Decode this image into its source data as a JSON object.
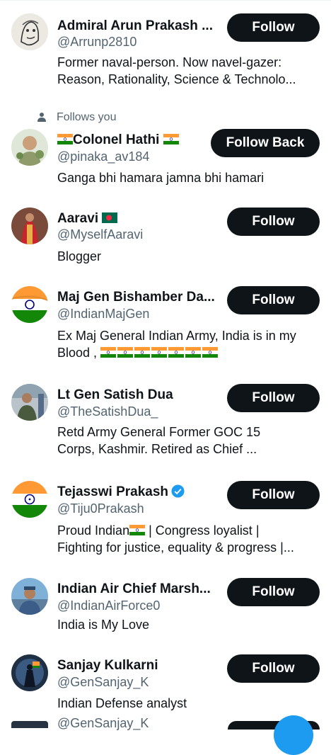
{
  "colors": {
    "text": "#0f1419",
    "muted": "#536471",
    "button": "#0f1419",
    "accent": "#1d9bf0"
  },
  "follows_you": {
    "icon": "person-icon",
    "label": "Follows you"
  },
  "users": [
    {
      "name": "Admiral Arun Prakash ...",
      "handle": "@Arrunp2810",
      "bio_lines": [
        "Former naval-person. Now navel-gazer:",
        "Reason, Rationality, Science & Technolo..."
      ],
      "button": "Follow"
    },
    {
      "name_prefix_flag": "india-flag",
      "name": "Colonel Hathi",
      "name_suffix_flag": "india-flag",
      "handle": "@pinaka_av184",
      "bio_lines": [
        "Ganga bhi hamara jamna bhi hamari"
      ],
      "button": "Follow Back"
    },
    {
      "name": "Aaravi",
      "name_suffix_flag": "bangladesh-flag",
      "handle": "@MyselfAaravi",
      "bio_lines": [
        "Blogger"
      ],
      "button": "Follow"
    },
    {
      "name": "Maj Gen Bishamber Da...",
      "handle": "@IndianMajGen",
      "bio_lines": [
        "Ex Maj General Indian Army, India is in my",
        "Blood , "
      ],
      "bio_flags": 7,
      "button": "Follow"
    },
    {
      "name": "Lt Gen Satish Dua",
      "handle": "@TheSatishDua_",
      "bio_lines": [
        "Retd Army General Former GOC 15",
        "Corps, Kashmir. Retired as Chief ..."
      ],
      "button": "Follow"
    },
    {
      "name": "Tejasswi Prakash",
      "verified": true,
      "handle": "@Tiju0Prakash",
      "bio_lines": [
        "Proud Indian",
        " | Congress loyalist  |",
        "Fighting for justice, equality & progress |..."
      ],
      "button": "Follow"
    },
    {
      "name": "Indian Air Chief Marsh...",
      "handle": "@IndianAirForce0",
      "bio_lines": [
        "India is My Love"
      ],
      "button": "Follow"
    },
    {
      "name": "Sanjay Kulkarni",
      "handle": "@GenSanjay_K",
      "bio_lines": [
        "Indian Defense analyst"
      ],
      "button": "Follow"
    }
  ],
  "peek_handle": "@GenSanjay_K"
}
